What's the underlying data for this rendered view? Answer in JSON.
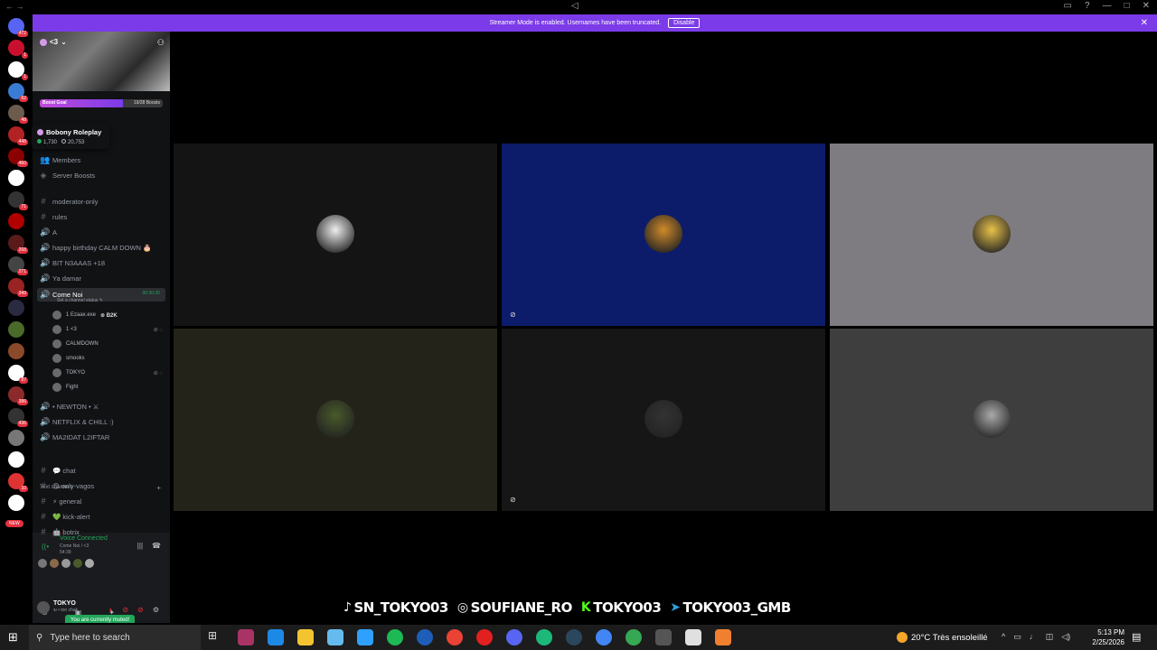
{
  "titlebar": {
    "nav": "←  →",
    "center_icon": "◁"
  },
  "rail": {
    "servers": [
      {
        "name": "discord-home-icon",
        "color": "#5865f2",
        "badge": "472"
      },
      {
        "name": "server-1-icon",
        "color": "#c8102e",
        "badge": "1"
      },
      {
        "name": "server-2-icon",
        "color": "#ffffff",
        "badge": "1"
      },
      {
        "name": "server-3-icon",
        "color": "#3a7bd5",
        "badge": "62"
      },
      {
        "name": "server-4-icon",
        "color": "#6b5b4d",
        "badge": "48"
      },
      {
        "name": "server-5-icon",
        "color": "#b22222",
        "badge": "448"
      },
      {
        "name": "server-6-icon",
        "color": "#8b0000",
        "badge": "460"
      },
      {
        "name": "server-7-icon",
        "color": "#ffffff",
        "badge": ""
      },
      {
        "name": "server-8-icon",
        "color": "#333333",
        "badge": "71"
      },
      {
        "name": "server-9-icon",
        "color": "#b00000",
        "badge": ""
      },
      {
        "name": "server-10-icon",
        "color": "#5a1a1a",
        "badge": "268"
      },
      {
        "name": "server-11-icon",
        "color": "#444444",
        "badge": "271"
      },
      {
        "name": "server-12-icon",
        "color": "#992222",
        "badge": "349"
      },
      {
        "name": "server-13-icon",
        "color": "#2a2a40",
        "badge": ""
      },
      {
        "name": "server-14-icon",
        "color": "#4a6a2a",
        "badge": ""
      },
      {
        "name": "server-15-icon",
        "color": "#8a4a2a",
        "badge": ""
      },
      {
        "name": "server-16-icon",
        "color": "#ffffff",
        "badge": "87"
      },
      {
        "name": "server-17-icon",
        "color": "#8a2a2a",
        "badge": "386"
      },
      {
        "name": "server-18-icon",
        "color": "#333333",
        "badge": "436"
      },
      {
        "name": "server-19-icon",
        "color": "#777777",
        "badge": ""
      },
      {
        "name": "server-20-icon",
        "color": "#ffffff",
        "badge": ""
      },
      {
        "name": "server-21-icon",
        "color": "#dd3333",
        "badge": "10"
      },
      {
        "name": "server-22-icon",
        "color": "#ffffff",
        "badge": ""
      }
    ],
    "new_label": "NEW"
  },
  "banner": {
    "text": "Streamer Mode is enabled. Usernames have been truncated.",
    "disable": "Disable",
    "color": "#7b3be8"
  },
  "guild": {
    "name": "<3",
    "boost_label": "Boost Goal",
    "boost_count": "19/28 Boosts",
    "boost_progress": 0.68
  },
  "tooltip": {
    "name": "Bobony Roleplay",
    "online": "1,730",
    "members": "20,753"
  },
  "channels": {
    "members": "Members",
    "server_boosts": "Server Boosts",
    "list": [
      {
        "label": "moderator-only",
        "icon": "#"
      },
      {
        "label": "rules",
        "icon": "#"
      },
      {
        "label": "A",
        "icon": "🔊"
      },
      {
        "label": "happy birthday CALM DOWN 🎂",
        "icon": "🔊"
      },
      {
        "label": "BIT N3AAAS +18",
        "icon": "🔊"
      },
      {
        "label": "Ya damar",
        "icon": "🔊"
      }
    ],
    "active": {
      "label": "Come Noi",
      "time": "00:30:35",
      "status": "Set a channel status ✎"
    },
    "voice_users": [
      {
        "name": "1 Ezaax.exe",
        "tag": "B2K"
      },
      {
        "name": "1 <3",
        "tag": ""
      },
      {
        "name": "CALMDOWN",
        "tag": ""
      },
      {
        "name": "smooks",
        "tag": ""
      },
      {
        "name": "TOKYO",
        "tag": ""
      },
      {
        "name": "Fight",
        "tag": ""
      }
    ],
    "list2": [
      {
        "label": "• NEWTON • ⚔",
        "icon": "🔊"
      },
      {
        "label": "NETFLIX & CHILL :)",
        "icon": "🔊"
      },
      {
        "label": "MA2IDAT L2IFTAR",
        "icon": "🔊"
      }
    ],
    "category": "Text channels",
    "text_channels": [
      {
        "label": "💬 chat"
      },
      {
        "label": "😊 only-vagos"
      },
      {
        "label": "⚡ general"
      },
      {
        "label": "💚 kick-alert"
      },
      {
        "label": "🤖 botrix"
      }
    ]
  },
  "voice": {
    "title": "Voice Connected",
    "channel": "Come Noi / <3",
    "time": "54:39",
    "toast": "You are currently muted!"
  },
  "me": {
    "name": "TOKYO",
    "status": "ฆ • ton chak"
  },
  "tiles": [
    {
      "bg": "#141414",
      "avatar": "#eeeeee",
      "cam": false
    },
    {
      "bg": "#0c1c6b",
      "avatar": "#d08a2a",
      "cam": true
    },
    {
      "bg": "#7e7c80",
      "avatar": "#e8c24a",
      "cam": false
    },
    {
      "bg": "#24231a",
      "avatar": "#4a5a2a",
      "cam": false
    },
    {
      "bg": "#161616",
      "avatar": "#333333",
      "cam": true
    },
    {
      "bg": "#3e3e3e",
      "avatar": "#aaaaaa",
      "cam": false
    }
  ],
  "socials": [
    {
      "icon": "♪",
      "text": "SN_TOKYO03"
    },
    {
      "icon": "◎",
      "text": "SOUFIANE_RO"
    },
    {
      "icon": "K",
      "text": "TOKYO03"
    },
    {
      "icon": "➤",
      "text": "TOKYO03_GMB"
    }
  ],
  "taskbar": {
    "search": "Type here to search",
    "weather": "20°C  Très ensoleillé",
    "time": "5:13 PM",
    "date": "2/25/2026"
  }
}
